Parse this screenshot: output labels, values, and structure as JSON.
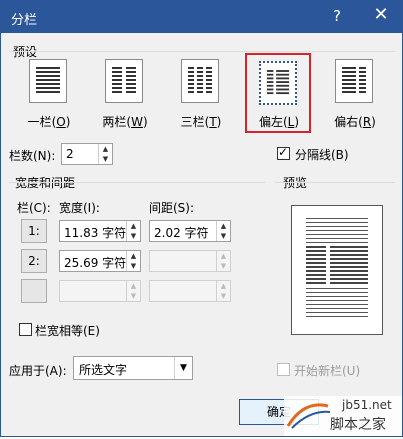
{
  "window": {
    "title": "分栏",
    "help": "?",
    "close": "✕"
  },
  "presets_group": "预设",
  "presets": [
    {
      "label": "一栏",
      "key": "O"
    },
    {
      "label": "两栏",
      "key": "W"
    },
    {
      "label": "三栏",
      "key": "T"
    },
    {
      "label": "偏左",
      "key": "L"
    },
    {
      "label": "偏右",
      "key": "R"
    }
  ],
  "columns": {
    "label": "栏数(N):",
    "value": "2"
  },
  "line_between": {
    "label": "分隔线(B)",
    "checked": true
  },
  "width_spacing": {
    "group": "宽度和间距",
    "col_header": "栏(C):",
    "width_header": "宽度(I):",
    "spacing_header": "间距(S):",
    "rows": [
      {
        "num": "1:",
        "width": "11.83 字符",
        "spacing": "2.02 字符"
      },
      {
        "num": "2:",
        "width": "25.69 字符",
        "spacing": ""
      },
      {
        "num": "",
        "width": "",
        "spacing": ""
      }
    ]
  },
  "equal_width": {
    "label": "栏宽相等(E)",
    "checked": false
  },
  "preview": {
    "label": "预览"
  },
  "apply_to": {
    "label": "应用于(A):",
    "value": "所选文字"
  },
  "new_column": {
    "label": "开始新栏(U)"
  },
  "ok_button": "确定",
  "watermark": {
    "line1": "jb51.net",
    "line2": "脚本之家"
  }
}
